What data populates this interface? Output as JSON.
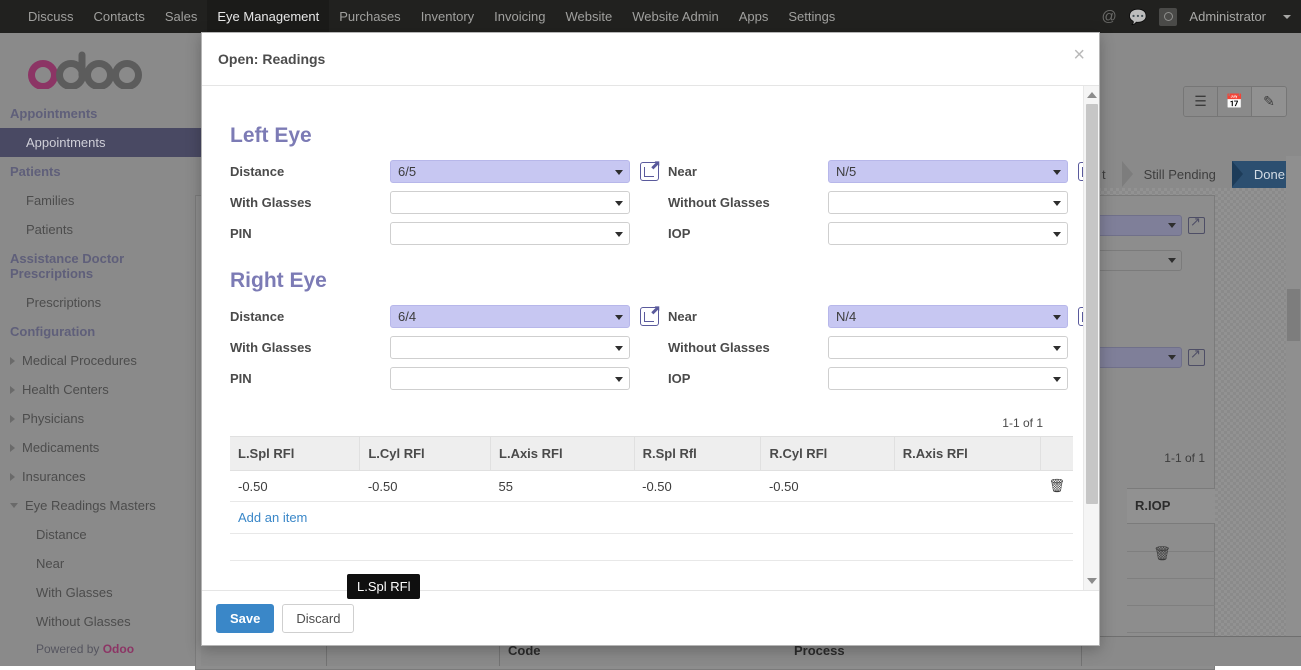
{
  "navbar": {
    "items": [
      {
        "label": "Discuss",
        "active": false
      },
      {
        "label": "Contacts",
        "active": false
      },
      {
        "label": "Sales",
        "active": false
      },
      {
        "label": "Eye Management",
        "active": true
      },
      {
        "label": "Purchases",
        "active": false
      },
      {
        "label": "Inventory",
        "active": false
      },
      {
        "label": "Invoicing",
        "active": false
      },
      {
        "label": "Website",
        "active": false
      },
      {
        "label": "Website Admin",
        "active": false
      },
      {
        "label": "Apps",
        "active": false
      },
      {
        "label": "Settings",
        "active": false
      }
    ],
    "mention_icon": "at-sign-icon",
    "messages_icon": "chat-bubble-icon",
    "avatar": "user-avatar",
    "user": "Administrator"
  },
  "sidebar": {
    "brand": "odoo",
    "sections": [
      {
        "heading": "Appointments",
        "links": [
          {
            "label": "Appointments",
            "selected": true
          }
        ]
      },
      {
        "heading": "Patients",
        "links": [
          {
            "label": "Families",
            "selected": false
          },
          {
            "label": "Patients",
            "selected": false
          }
        ]
      },
      {
        "heading": "Assistance Doctor Prescriptions",
        "links": [
          {
            "label": "Prescriptions",
            "selected": false
          }
        ]
      }
    ],
    "config_heading": "Configuration",
    "tree": [
      {
        "label": "Medical Procedures",
        "expanded": false
      },
      {
        "label": "Health Centers",
        "expanded": false
      },
      {
        "label": "Physicians",
        "expanded": false
      },
      {
        "label": "Medicaments",
        "expanded": false
      },
      {
        "label": "Insurances",
        "expanded": false
      },
      {
        "label": "Eye Readings Masters",
        "expanded": true
      }
    ],
    "eye_readings_children": [
      "Distance",
      "Near",
      "With Glasses",
      "Without Glasses"
    ],
    "powered_prefix": "Powered by ",
    "powered_brand": "Odoo"
  },
  "background": {
    "view_buttons": [
      {
        "icon": "list-view-icon",
        "label": "☰"
      },
      {
        "icon": "calendar-view-icon",
        "label": "Ὄ5"
      },
      {
        "icon": "form-view-icon",
        "label": "✎"
      }
    ],
    "status_steps": [
      {
        "label": "t",
        "active": false
      },
      {
        "label": "Still Pending",
        "active": false
      },
      {
        "label": "Done",
        "active": true
      }
    ],
    "record_count": "1-1 of 1",
    "table_header": "R.IOP",
    "bottom_headers": [
      {
        "label": "Code"
      },
      {
        "label": "Process"
      }
    ]
  },
  "modal": {
    "title": "Open: Readings",
    "close_label": "×",
    "sections": [
      {
        "heading": "Left Eye",
        "rows": [
          {
            "left": {
              "label": "Distance",
              "value": "6/5",
              "filled": true,
              "external_link": true
            },
            "right": {
              "label": "Near",
              "value": "N/5",
              "filled": true,
              "external_link": true
            }
          },
          {
            "left": {
              "label": "With Glasses",
              "value": "",
              "filled": false,
              "external_link": false
            },
            "right": {
              "label": "Without Glasses",
              "value": "",
              "filled": false,
              "external_link": false
            }
          },
          {
            "left": {
              "label": "PIN",
              "value": "",
              "filled": false,
              "external_link": false
            },
            "right": {
              "label": "IOP",
              "value": "",
              "filled": false,
              "external_link": false
            }
          }
        ]
      },
      {
        "heading": "Right Eye",
        "rows": [
          {
            "left": {
              "label": "Distance",
              "value": "6/4",
              "filled": true,
              "external_link": true
            },
            "right": {
              "label": "Near",
              "value": "N/4",
              "filled": true,
              "external_link": true
            }
          },
          {
            "left": {
              "label": "With Glasses",
              "value": "",
              "filled": false,
              "external_link": false
            },
            "right": {
              "label": "Without Glasses",
              "value": "",
              "filled": false,
              "external_link": false
            }
          },
          {
            "left": {
              "label": "PIN",
              "value": "",
              "filled": false,
              "external_link": false
            },
            "right": {
              "label": "IOP",
              "value": "",
              "filled": false,
              "external_link": false
            }
          }
        ]
      }
    ],
    "o2m": {
      "count": "1-1 of 1",
      "columns": [
        "L.Spl RFl",
        "L.Cyl RFl",
        "L.Axis RFl",
        "R.Spl Rfl",
        "R.Cyl RFl",
        "R.Axis RFl"
      ],
      "rows": [
        [
          "-0.50",
          "-0.50",
          "55",
          "-0.50",
          "-0.50",
          ""
        ]
      ],
      "add_label": "Add an item",
      "delete_icon": "trash-icon"
    },
    "footer": {
      "save_label": "Save",
      "discard_label": "Discard"
    }
  },
  "tooltip": {
    "text": "L.Spl RFl"
  },
  "colors": {
    "navbar_bg": "#21211f",
    "accent_blue": "#3a87c8",
    "eye_title": "#7c7bb5",
    "filled_field": "#c7c7f2",
    "status_done": "#2c4f70",
    "brand_purple": "#8c3565"
  }
}
